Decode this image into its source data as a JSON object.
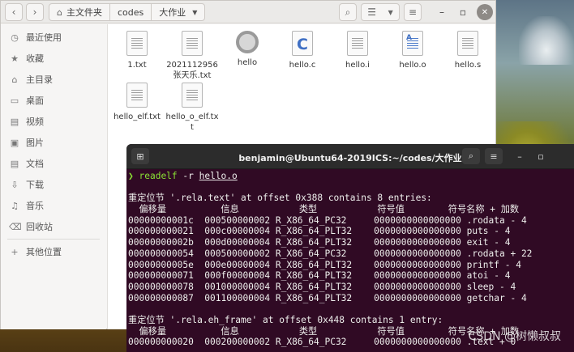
{
  "file_manager": {
    "breadcrumbs": [
      "主文件夹",
      "codes",
      "大作业"
    ],
    "sidebar": [
      {
        "label": "最近使用",
        "icon": "clock-icon",
        "glyph": "◷"
      },
      {
        "label": "收藏",
        "icon": "star-icon",
        "glyph": "★"
      },
      {
        "label": "主目录",
        "icon": "home-icon",
        "glyph": "⌂"
      },
      {
        "label": "桌面",
        "icon": "desktop-icon",
        "glyph": "▭"
      },
      {
        "label": "视频",
        "icon": "video-icon",
        "glyph": "▤"
      },
      {
        "label": "图片",
        "icon": "image-icon",
        "glyph": "▣"
      },
      {
        "label": "文档",
        "icon": "document-icon",
        "glyph": "▤"
      },
      {
        "label": "下载",
        "icon": "download-icon",
        "glyph": "⇩"
      },
      {
        "label": "音乐",
        "icon": "music-icon",
        "glyph": "♫"
      },
      {
        "label": "回收站",
        "icon": "trash-icon",
        "glyph": "⌫"
      },
      {
        "label": "其他位置",
        "icon": "plus-icon",
        "glyph": "+"
      }
    ],
    "files": [
      {
        "name": "1.txt",
        "type": "text"
      },
      {
        "name": "2021112956张天乐.txt",
        "type": "text"
      },
      {
        "name": "hello",
        "type": "executable"
      },
      {
        "name": "hello.c",
        "type": "c-source"
      },
      {
        "name": "hello.i",
        "type": "text"
      },
      {
        "name": "hello.o",
        "type": "object"
      },
      {
        "name": "hello.s",
        "type": "text"
      },
      {
        "name": "hello_elf.txt",
        "type": "text"
      },
      {
        "name": "hello_o_elf.txt",
        "type": "text"
      }
    ]
  },
  "terminal": {
    "title": "benjamin@Ubuntu64-2019ICS:~/codes/大作业",
    "prompt_symbol": "❯",
    "command": "readelf",
    "command_args": " -r ",
    "command_file": "hello.o",
    "lines": [
      "",
      "重定位节 '.rela.text' at offset 0x388 contains 8 entries:",
      "  偏移量          信息           类型           符号值        符号名称 + 加数",
      "00000000001c  000500000002 R_X86_64_PC32     0000000000000000 .rodata - 4",
      "000000000021  000c00000004 R_X86_64_PLT32    0000000000000000 puts - 4",
      "00000000002b  000d00000004 R_X86_64_PLT32    0000000000000000 exit - 4",
      "000000000054  000500000002 R_X86_64_PC32     0000000000000000 .rodata + 22",
      "00000000005e  000e00000004 R_X86_64_PLT32    0000000000000000 printf - 4",
      "000000000071  000f00000004 R_X86_64_PLT32    0000000000000000 atoi - 4",
      "000000000078  001000000004 R_X86_64_PLT32    0000000000000000 sleep - 4",
      "000000000087  001100000004 R_X86_64_PLT32    0000000000000000 getchar - 4",
      "",
      "重定位节 '.rela.eh_frame' at offset 0x448 contains 1 entry:",
      "  偏移量          信息           类型           符号值        符号名称 + 加数",
      "000000000020  000200000002 R_X86_64_PC32     0000000000000000 .text + 0"
    ]
  },
  "watermark": "CSDN @树懒叔叔"
}
